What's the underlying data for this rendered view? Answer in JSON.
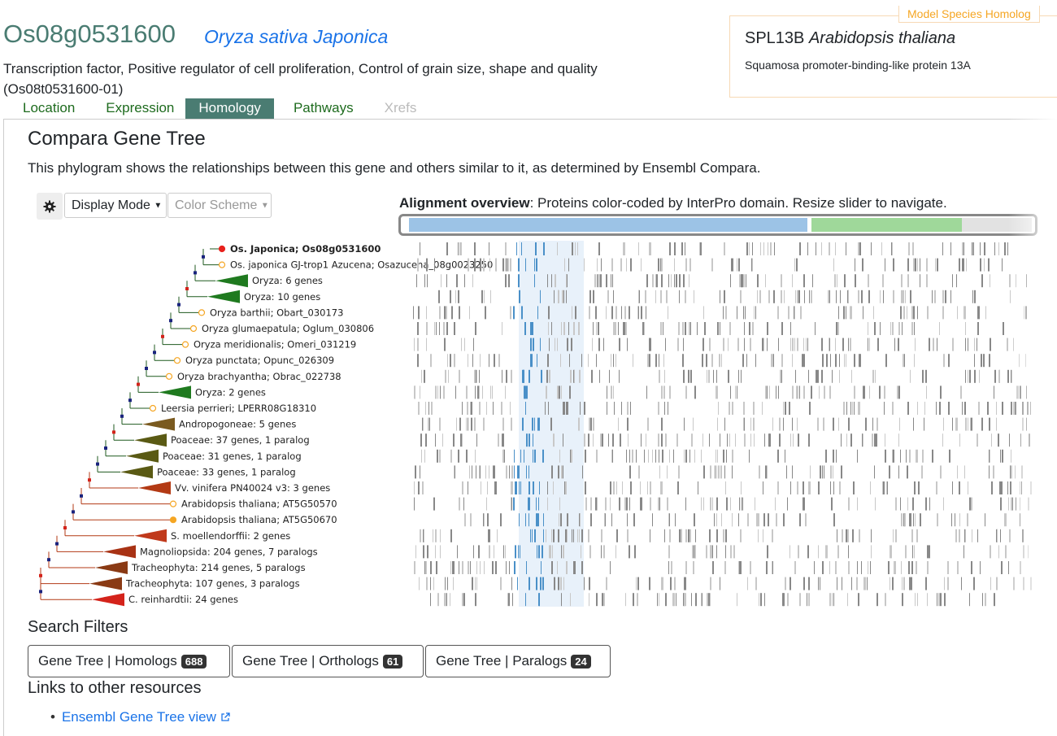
{
  "gene": {
    "id": "Os08g0531600",
    "species": "Oryza sativa Japonica",
    "description": "Transcription factor, Positive regulator of cell proliferation, Control of grain size, shape and quality",
    "transcript": "(Os08t0531600-01)"
  },
  "homolog": {
    "badge": "Model Species Homolog",
    "name": "SPL13B",
    "species": "Arabidopsis thaliana",
    "description": "Squamosa promoter-binding-like protein 13A"
  },
  "tabs": [
    {
      "label": "Location",
      "state": "normal"
    },
    {
      "label": "Expression",
      "state": "normal"
    },
    {
      "label": "Homology",
      "state": "active"
    },
    {
      "label": "Pathways",
      "state": "normal"
    },
    {
      "label": "Xrefs",
      "state": "disabled"
    }
  ],
  "section": {
    "title": "Compara Gene Tree",
    "description": "This phylogram shows the relationships between this gene and others similar to it, as determined by Ensembl Compara."
  },
  "controls": {
    "gear_icon": "gear-icon",
    "display_mode": "Display Mode",
    "color_scheme": "Color Scheme"
  },
  "alignment": {
    "title_bold": "Alignment overview",
    "title_rest": ": Proteins color-coded by InterPro domain. Resize slider to navigate."
  },
  "tree_leaves": [
    {
      "label": "Os. Japonica; Os08g0531600",
      "type": "gene",
      "bold": true,
      "marker": "#e8211c"
    },
    {
      "label": "Os. japonica GJ-trop1 Azucena; Osazucena_08g0023250",
      "type": "gene",
      "marker": "#f5a623"
    },
    {
      "label": "Oryza: 6 genes",
      "type": "clade",
      "color": "#1f7a1f"
    },
    {
      "label": "Oryza: 10 genes",
      "type": "clade",
      "color": "#1f7a1f"
    },
    {
      "label": "Oryza barthii; Obart_030173",
      "type": "gene",
      "marker": "#f5a623"
    },
    {
      "label": "Oryza glumaepatula; Oglum_030806",
      "type": "gene",
      "marker": "#f5a623"
    },
    {
      "label": "Oryza meridionalis; Omeri_031219",
      "type": "gene",
      "marker": "#f5a623"
    },
    {
      "label": "Oryza punctata; Opunc_026309",
      "type": "gene",
      "marker": "#f5a623"
    },
    {
      "label": "Oryza brachyantha; Obrac_022738",
      "type": "gene",
      "marker": "#f5a623"
    },
    {
      "label": "Oryza: 2 genes",
      "type": "clade",
      "color": "#1f7a1f"
    },
    {
      "label": "Leersia perrieri; LPERR08G18310",
      "type": "gene",
      "marker": "#f5a623"
    },
    {
      "label": "Andropogoneae: 5 genes",
      "type": "clade",
      "color": "#7a5a1f"
    },
    {
      "label": "Poaceae: 37 genes, 1 paralog",
      "type": "clade",
      "color": "#5a5a14"
    },
    {
      "label": "Poaceae: 31 genes, 1 paralog",
      "type": "clade",
      "color": "#5a5a14"
    },
    {
      "label": "Poaceae: 33 genes, 1 paralog",
      "type": "clade",
      "color": "#5a5a14"
    },
    {
      "label": "Vv. vinifera PN40024 v3: 3 genes",
      "type": "clade",
      "color": "#b33a14"
    },
    {
      "label": "Arabidopsis thaliana; AT5G50570",
      "type": "gene",
      "marker": "#f5a623"
    },
    {
      "label": "Arabidopsis thaliana; AT5G50670",
      "type": "gene",
      "marker": "#f5a623",
      "filled": true
    },
    {
      "label": "S. moellendorffii: 2 genes",
      "type": "clade",
      "color": "#c0391b"
    },
    {
      "label": "Magnoliopsida: 204 genes, 7 paralogs",
      "type": "clade",
      "color": "#a83214"
    },
    {
      "label": "Tracheophyta: 214 genes, 5 paralogs",
      "type": "clade",
      "color": "#8a3a14"
    },
    {
      "label": "Tracheophyta: 107 genes, 3 paralogs",
      "type": "clade",
      "color": "#8a3a14"
    },
    {
      "label": "C. reinhardtii: 24 genes",
      "type": "clade",
      "color": "#d4231b"
    }
  ],
  "filters": {
    "title": "Search Filters",
    "buttons": [
      {
        "label": "Gene Tree | Homologs",
        "count": "688"
      },
      {
        "label": "Gene Tree | Orthologs",
        "count": "61"
      },
      {
        "label": "Gene Tree | Paralogs",
        "count": "24"
      }
    ]
  },
  "links": {
    "title": "Links to other resources",
    "ensembl_label": "Ensembl Gene Tree view",
    "external_icon": "external-link-icon"
  },
  "colors": {
    "brand": "#4a7c72",
    "link": "#1a73e8",
    "homolog_accent": "#f5a623"
  }
}
